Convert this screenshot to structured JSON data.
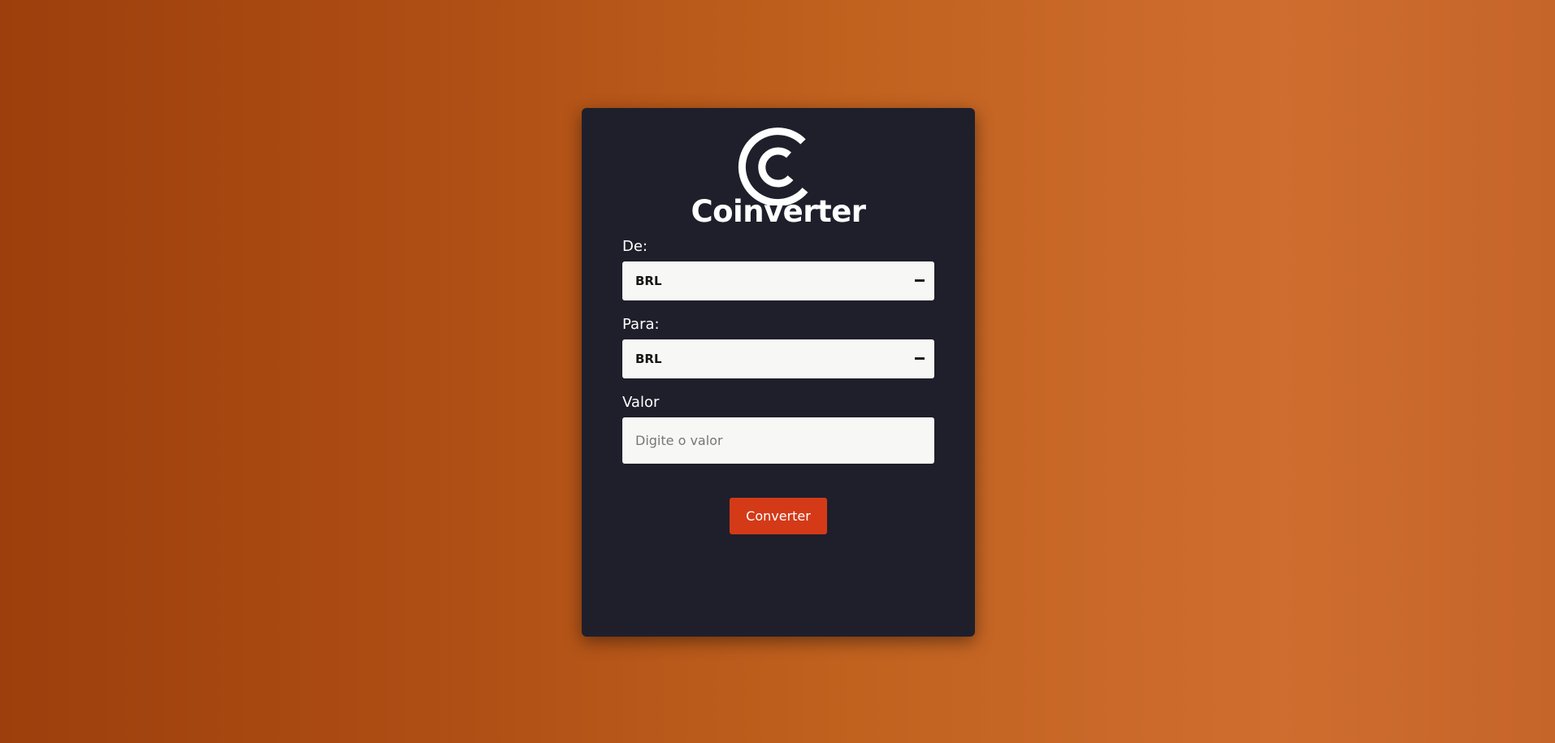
{
  "app": {
    "title": "Coinverter"
  },
  "logo": {
    "icon": "coin-c-logo-icon"
  },
  "form": {
    "from_label": "De:",
    "from_value": "BRL",
    "to_label": "Para:",
    "to_value": "BRL",
    "value_label": "Valor",
    "value_placeholder": "Digite o valor",
    "value_current": "",
    "convert_label": "Converter"
  },
  "colors": {
    "card_background": "#1f1f2b",
    "accent": "#d43a18",
    "field_background": "#f7f7f5"
  }
}
